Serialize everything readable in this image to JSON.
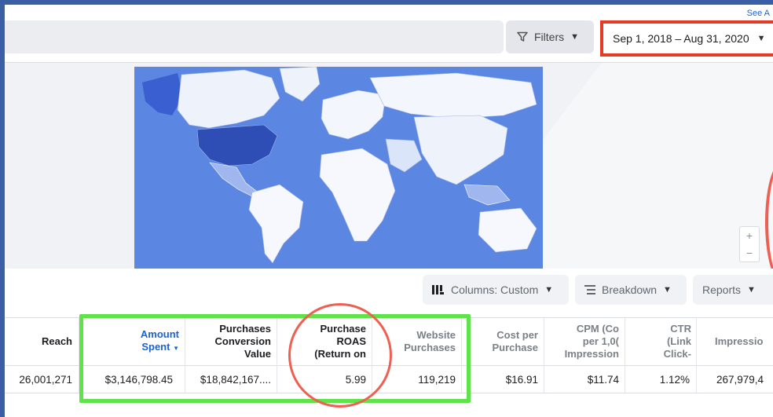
{
  "header": {
    "see_all": "See A",
    "filters_label": "Filters",
    "date_range": "Sep 1, 2018 – Aug 31, 2020"
  },
  "map": {
    "zoom_in": "+",
    "zoom_out": "−"
  },
  "toolbar": {
    "columns_label": "Columns: Custom",
    "breakdown_label": "Breakdown",
    "reports_label": "Reports"
  },
  "table": {
    "headers": {
      "reach": [
        "Reach"
      ],
      "amount_spent": [
        "Amount",
        "Spent"
      ],
      "purchases_conversion_value": [
        "Purchases",
        "Conversion",
        "Value"
      ],
      "purchase_roas": [
        "Purchase",
        "ROAS",
        "(Return on"
      ],
      "website_purchases": [
        "Website",
        "Purchases"
      ],
      "cost_per_purchase": [
        "Cost per",
        "Purchase"
      ],
      "cpm": [
        "CPM (Co",
        "per 1,0(",
        "Impression"
      ],
      "ctr": [
        "CTR",
        "(Link",
        "Click-"
      ],
      "impressions": [
        "Impressio"
      ]
    },
    "row": {
      "reach": "26,001,271",
      "amount_spent": "$3,146,798.45",
      "purchases_conversion_value": "$18,842,167....",
      "purchase_roas": "5.99",
      "website_purchases": "119,219",
      "cost_per_purchase": "$16.91",
      "cpm": "$11.74",
      "ctr": "1.12%",
      "impressions": "267,979,4"
    }
  },
  "colors": {
    "highlight_red": "#e33b25",
    "highlight_green": "#5fe34a",
    "link_blue": "#1a63d6",
    "map_blue": "#5b87e3"
  }
}
